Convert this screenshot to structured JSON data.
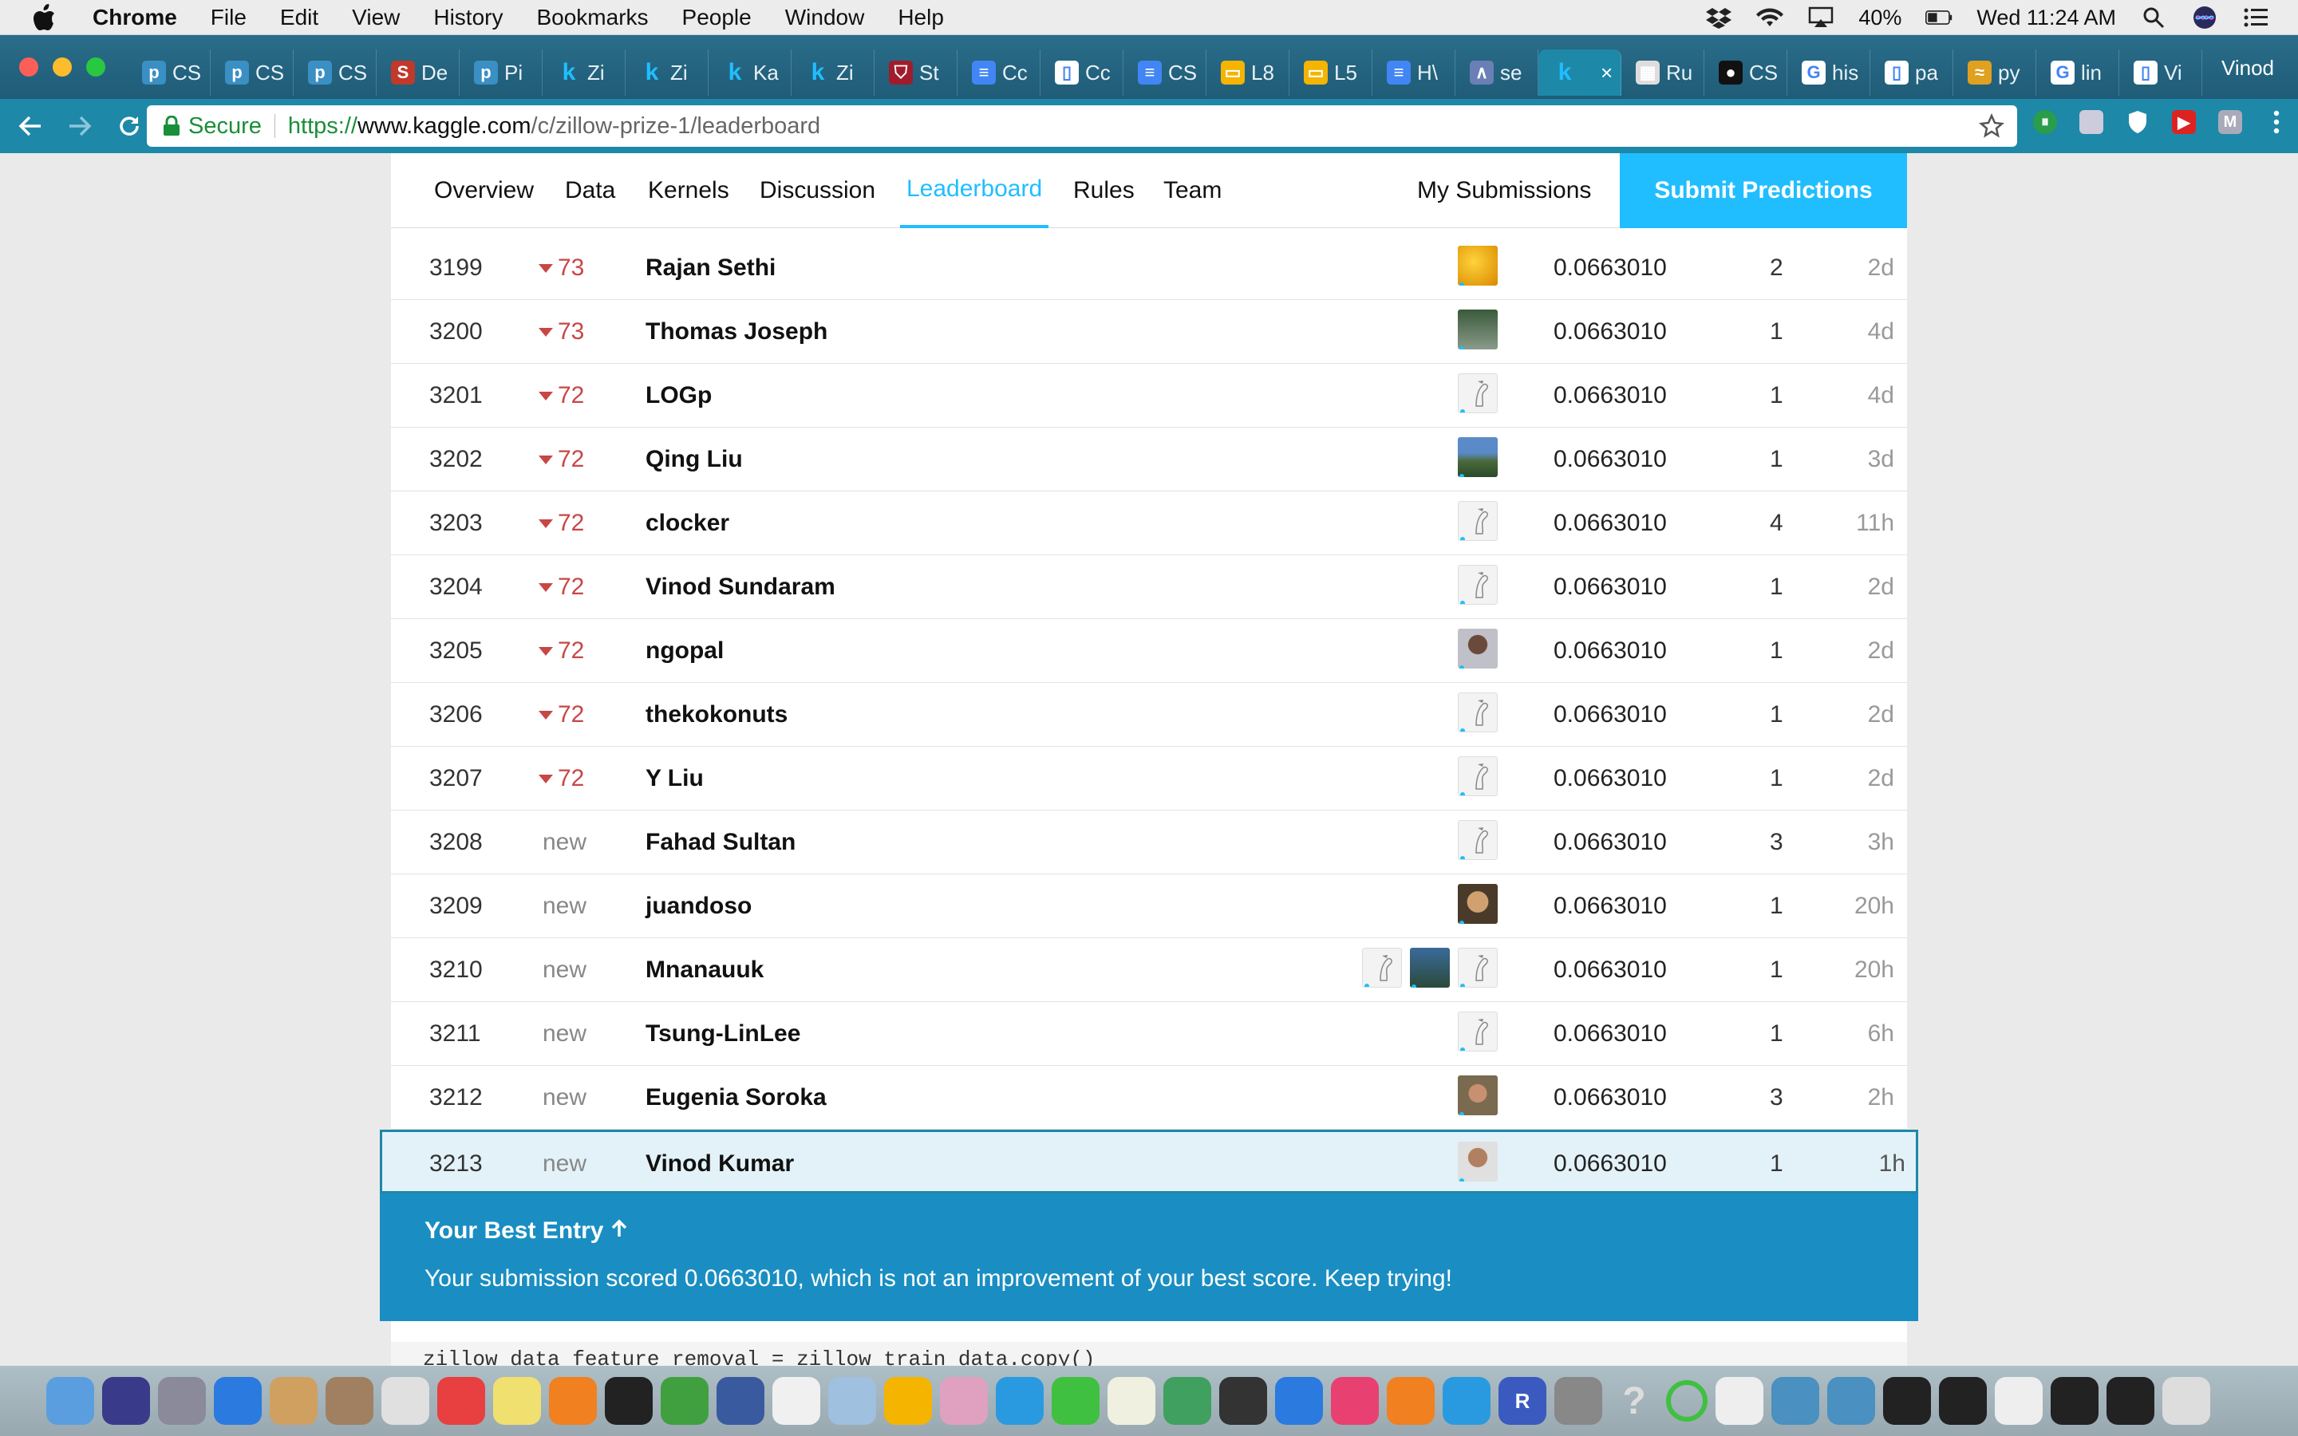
{
  "menubar": {
    "app": "Chrome",
    "items": [
      "File",
      "Edit",
      "View",
      "History",
      "Bookmarks",
      "People",
      "Window",
      "Help"
    ],
    "battery": "40%",
    "clock": "Wed 11:24 AM"
  },
  "tabs": [
    {
      "label": "CS",
      "icon": "p-icon",
      "color": "#3a8fc4"
    },
    {
      "label": "CS",
      "icon": "p-icon",
      "color": "#3a8fc4"
    },
    {
      "label": "CS",
      "icon": "p-icon",
      "color": "#3a8fc4"
    },
    {
      "label": "De",
      "icon": "s-icon",
      "color": "#c0392b"
    },
    {
      "label": "Pi",
      "icon": "p-icon",
      "color": "#3a8fc4"
    },
    {
      "label": "Zi",
      "icon": "kaggle-icon",
      "color": "#20beff"
    },
    {
      "label": "Zi",
      "icon": "kaggle-icon",
      "color": "#20beff"
    },
    {
      "label": "Ka",
      "icon": "kaggle-icon",
      "color": "#20beff"
    },
    {
      "label": "Zi",
      "icon": "kaggle-icon",
      "color": "#20beff"
    },
    {
      "label": "St",
      "icon": "shield-icon",
      "color": "#a01c2c"
    },
    {
      "label": "Cc",
      "icon": "doc-icon",
      "color": "#4285f4"
    },
    {
      "label": "Cc",
      "icon": "page-icon",
      "color": "#ffffff"
    },
    {
      "label": "CS",
      "icon": "doc-icon",
      "color": "#4285f4"
    },
    {
      "label": "L8",
      "icon": "slides-icon",
      "color": "#f4b400"
    },
    {
      "label": "L5",
      "icon": "slides-icon",
      "color": "#f4b400"
    },
    {
      "label": "H\\",
      "icon": "doc-icon",
      "color": "#4285f4"
    },
    {
      "label": "se",
      "icon": "chart-icon",
      "color": "#6a7fb5"
    },
    {
      "label": "",
      "icon": "kaggle-icon",
      "color": "#20beff",
      "active": true,
      "close": "×"
    },
    {
      "label": "Ru",
      "icon": "table-icon",
      "color": "#dddddd"
    },
    {
      "label": "CS",
      "icon": "github-icon",
      "color": "#111111"
    },
    {
      "label": "his",
      "icon": "google-icon",
      "color": "#ffffff"
    },
    {
      "label": "pa",
      "icon": "page-icon",
      "color": "#ffffff"
    },
    {
      "label": "py",
      "icon": "python-icon",
      "color": "#e0a020"
    },
    {
      "label": "lin",
      "icon": "google-icon",
      "color": "#ffffff"
    },
    {
      "label": "Vi",
      "icon": "page-icon",
      "color": "#ffffff"
    }
  ],
  "profile": "Vinod",
  "omnibox": {
    "secure": "Secure",
    "scheme": "https://",
    "host": "www.kaggle.com",
    "path": "/c/zillow-prize-1/leaderboard"
  },
  "competition_nav": {
    "links": [
      "Overview",
      "Data",
      "Kernels",
      "Discussion",
      "Leaderboard",
      "Rules",
      "Team"
    ],
    "active": "Leaderboard",
    "my_submissions": "My Submissions",
    "submit": "Submit Predictions"
  },
  "leaderboard": [
    {
      "rank": "3199",
      "change": "73",
      "dir": "down",
      "team": "Rajan Sethi",
      "avatars": [
        "flower"
      ],
      "score": "0.0663010",
      "entries": "2",
      "last": "2d"
    },
    {
      "rank": "3200",
      "change": "73",
      "dir": "down",
      "team": "Thomas Joseph",
      "avatars": [
        "photo-a"
      ],
      "score": "0.0663010",
      "entries": "1",
      "last": "4d"
    },
    {
      "rank": "3201",
      "change": "72",
      "dir": "down",
      "team": "LOGp",
      "avatars": [
        "default"
      ],
      "score": "0.0663010",
      "entries": "1",
      "last": "4d"
    },
    {
      "rank": "3202",
      "change": "72",
      "dir": "down",
      "team": "Qing Liu",
      "avatars": [
        "landscape"
      ],
      "score": "0.0663010",
      "entries": "1",
      "last": "3d"
    },
    {
      "rank": "3203",
      "change": "72",
      "dir": "down",
      "team": "clocker",
      "avatars": [
        "default"
      ],
      "score": "0.0663010",
      "entries": "4",
      "last": "11h"
    },
    {
      "rank": "3204",
      "change": "72",
      "dir": "down",
      "team": "Vinod Sundaram",
      "avatars": [
        "default"
      ],
      "score": "0.0663010",
      "entries": "1",
      "last": "2d"
    },
    {
      "rank": "3205",
      "change": "72",
      "dir": "down",
      "team": "ngopal",
      "avatars": [
        "photo-b"
      ],
      "score": "0.0663010",
      "entries": "1",
      "last": "2d"
    },
    {
      "rank": "3206",
      "change": "72",
      "dir": "down",
      "team": "thekokonuts",
      "avatars": [
        "default"
      ],
      "score": "0.0663010",
      "entries": "1",
      "last": "2d"
    },
    {
      "rank": "3207",
      "change": "72",
      "dir": "down",
      "team": "Y Liu",
      "avatars": [
        "default"
      ],
      "score": "0.0663010",
      "entries": "1",
      "last": "2d"
    },
    {
      "rank": "3208",
      "change": "new",
      "dir": "new",
      "team": "Fahad Sultan",
      "avatars": [
        "default"
      ],
      "score": "0.0663010",
      "entries": "3",
      "last": "3h"
    },
    {
      "rank": "3209",
      "change": "new",
      "dir": "new",
      "team": "juandoso",
      "avatars": [
        "photo-c"
      ],
      "score": "0.0663010",
      "entries": "1",
      "last": "20h"
    },
    {
      "rank": "3210",
      "change": "new",
      "dir": "new",
      "team": "Mnanauuk",
      "avatars": [
        "default",
        "photo-d",
        "default"
      ],
      "score": "0.0663010",
      "entries": "1",
      "last": "20h"
    },
    {
      "rank": "3211",
      "change": "new",
      "dir": "new",
      "team": "Tsung-LinLee",
      "avatars": [
        "default"
      ],
      "score": "0.0663010",
      "entries": "1",
      "last": "6h"
    },
    {
      "rank": "3212",
      "change": "new",
      "dir": "new",
      "team": "Eugenia Soroka",
      "avatars": [
        "photo-e"
      ],
      "score": "0.0663010",
      "entries": "3",
      "last": "2h"
    },
    {
      "rank": "3213",
      "change": "new",
      "dir": "new",
      "team": "Vinod Kumar",
      "avatars": [
        "photo-f"
      ],
      "score": "0.0663010",
      "entries": "1",
      "last": "1h",
      "highlight": true
    }
  ],
  "best_entry": {
    "title": "Your Best Entry",
    "message": "Your submission scored 0.0663010, which is not an improvement of your best score. Keep trying!"
  },
  "code_strip": "zillow_data_feature_removal = zillow_train_data.copy()",
  "dock": [
    "finder",
    "siri",
    "launchpad",
    "safari",
    "mail",
    "contacts",
    "chrome",
    "calendar",
    "notes",
    "sublime",
    "terminal",
    "evernote",
    "virtualbox",
    "reminders",
    "preview",
    "drive",
    "photos",
    "messages",
    "facetime",
    "textedit",
    "numbers",
    "dashboard",
    "keynote",
    "itunes",
    "ibooks",
    "appstore",
    "r",
    "preferences",
    "help",
    "spinner",
    "file",
    "folder",
    "folder",
    "window",
    "window",
    "window",
    "window",
    "window",
    "trash"
  ],
  "colors": {
    "kaggle_blue": "#20beff",
    "best_entry_bg": "#1a8ec2",
    "drop_red": "#c94646"
  }
}
